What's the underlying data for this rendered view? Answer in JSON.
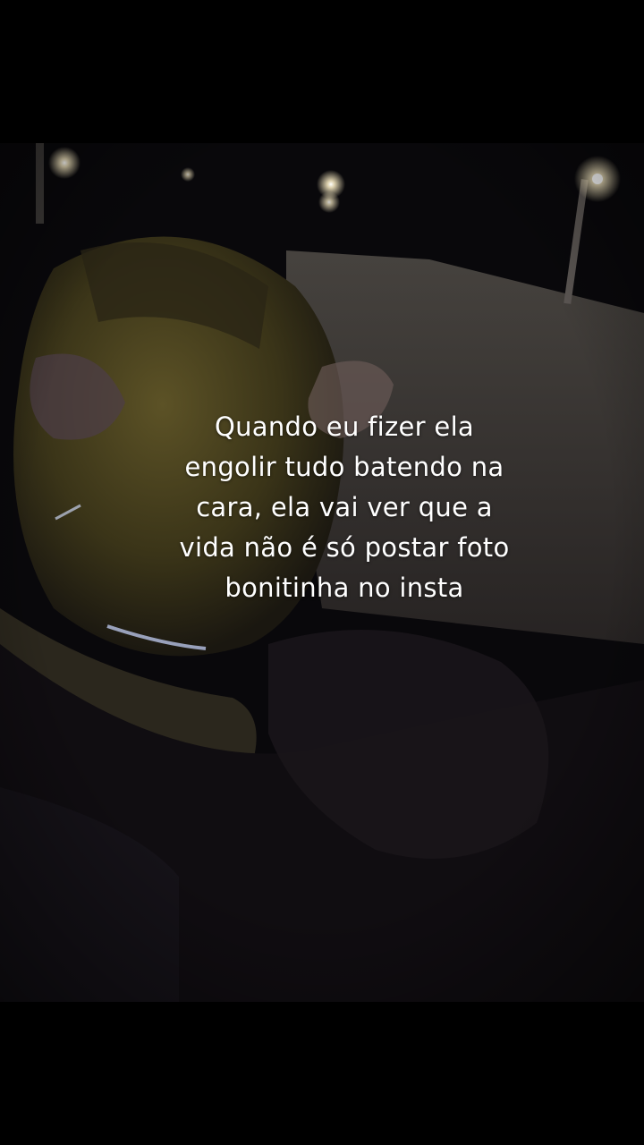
{
  "story": {
    "caption_text": "Quando eu fizer  ela\nengolir tudo batendo na\ncara, ela vai ver que a\nvida não é só postar foto\nbonitinha no insta"
  },
  "colors": {
    "background": "#000000",
    "caption": "#ffffff",
    "night_sky": "#08070a",
    "ground": "#4a4542",
    "street_light": "#fff6d8",
    "jacket_yellow": "#4f4721"
  }
}
